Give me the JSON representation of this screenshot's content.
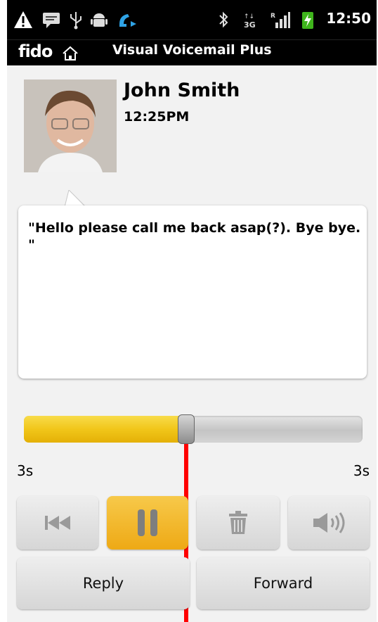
{
  "status_bar": {
    "time": "12:50",
    "icons": [
      "warning-icon",
      "message-icon",
      "usb-icon",
      "android-debug-icon",
      "call-forward-icon",
      "bluetooth-icon",
      "data-3g-icon",
      "signal-roaming-icon",
      "battery-charging-icon"
    ]
  },
  "title_bar": {
    "brand": "fido",
    "brand_icon": "home-icon",
    "title": "Visual Voicemail Plus"
  },
  "message": {
    "caller_name": "John Smith",
    "received_time": "12:25PM",
    "transcript": "\"Hello please call me back asap(?). Bye bye. \""
  },
  "player": {
    "progress": 0.48,
    "elapsed": "3s",
    "duration": "3s"
  },
  "controls": {
    "rewind_icon": "rewind-icon",
    "pause_icon": "pause-icon",
    "delete_icon": "trash-icon",
    "speaker_icon": "speaker-icon",
    "reply_label": "Reply",
    "forward_label": "Forward"
  },
  "colors": {
    "accent": "#f1c61a",
    "active_button": "#eea915",
    "playhead": "#ff0000"
  }
}
